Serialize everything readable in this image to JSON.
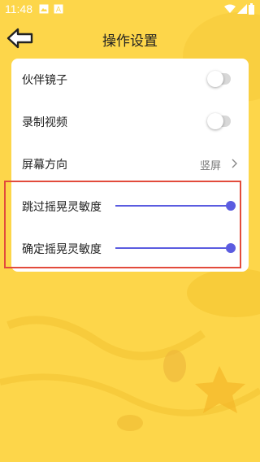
{
  "status_bar": {
    "time": "11:48",
    "icons": [
      "image-icon",
      "a-badge-icon",
      "wifi-icon",
      "signal-icon",
      "battery-icon"
    ]
  },
  "header": {
    "title": "操作设置",
    "back_icon": "back-arrow-icon"
  },
  "settings": {
    "partner_mirror": {
      "label": "伙伴镜子",
      "enabled": false
    },
    "record_video": {
      "label": "录制视频",
      "enabled": false
    },
    "screen_orientation": {
      "label": "屏幕方向",
      "value": "竖屏"
    },
    "skip_shake_sensitivity": {
      "label": "跳过摇晃灵敏度",
      "level": 1.0
    },
    "confirm_shake_sensitivity": {
      "label": "确定摇晃灵敏度",
      "level": 1.0
    }
  },
  "colors": {
    "background": "#FDD64A",
    "slider_accent": "#5B5CE0",
    "highlight_border": "#E24B3C"
  }
}
